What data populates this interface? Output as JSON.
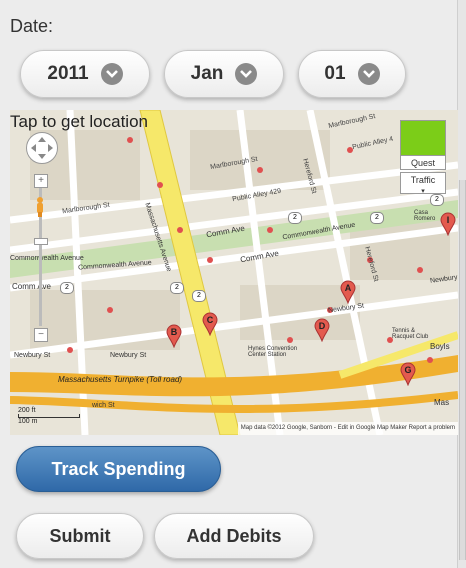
{
  "form": {
    "date_label": "Date:",
    "year": "2011",
    "month": "Jan",
    "day": "01"
  },
  "map": {
    "tap_label": "Tap to get location",
    "map_type_label": "Quest",
    "traffic_label": "Traffic",
    "attribution": "Map data ©2012 Google, Sanborn - Edit in Google Map Maker  Report a problem",
    "scale_ft": "200 ft",
    "scale_m": "100 m",
    "streets": {
      "marlborough_1": "Marlborough St",
      "marlborough_2": "Marlborough St",
      "marlborough_3": "Marlborough St",
      "public_alley_1": "Public Alley 429",
      "public_alley_2": "Public Alley 4",
      "comm_ave_1": "Comm Ave",
      "comm_ave_2": "Comm Ave",
      "comm_ave_3": "Comm Ave",
      "commonwealth_1": "Commonwealth Avenue",
      "commonwealth_2": "Commonwealth Avenue",
      "commonwealth_3": "Commonwealth Avenue",
      "massachusetts_ave": "Massachusetts Avenue",
      "hereford_1": "Hereford St",
      "hereford_2": "Hereford St",
      "newbury_1": "Newbury St",
      "newbury_2": "Newbury St",
      "newbury_3": "Newbury St",
      "newbury_4": "Newbury",
      "mass_turnpike": "Massachusetts Turnpike (Toll road)",
      "hynes": "Hynes Convention Center Station",
      "tennis": "Tennis & Racquet Club",
      "boylston": "Boyls",
      "mas": "Mas",
      "sandwich": "wich St",
      "casa": "Casa Romero"
    },
    "markers": [
      "A",
      "B",
      "C",
      "D",
      "G",
      "I"
    ],
    "route_badges": [
      "2",
      "2",
      "2",
      "2",
      "2",
      "2"
    ]
  },
  "actions": {
    "track_spending": "Track Spending",
    "submit": "Submit",
    "add_debits": "Add Debits"
  },
  "colors": {
    "primary_button": "#2f69a8",
    "highway": "#f0b030",
    "major_road": "#f6e86a",
    "park": "#c8dfb0"
  }
}
